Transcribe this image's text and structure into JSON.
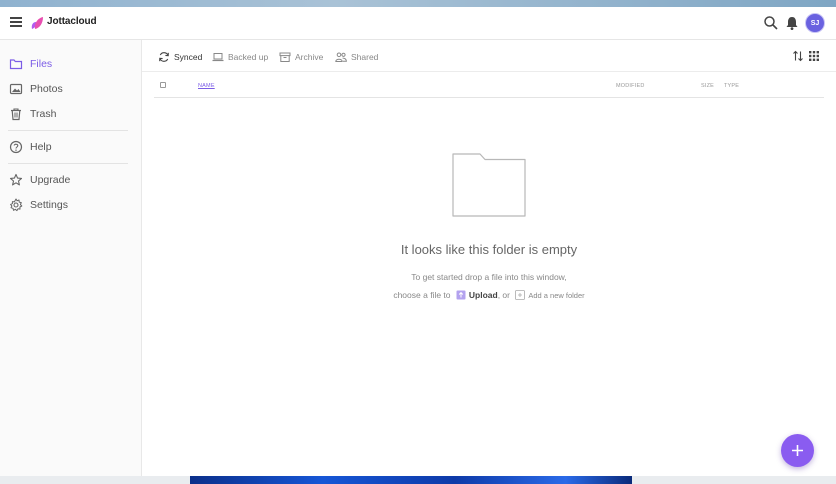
{
  "app": {
    "brand": "Jottacloud",
    "avatar_initials": "SJ",
    "accent_color": "#7b5ce6"
  },
  "header": {
    "icons": [
      "menu-icon",
      "search-icon",
      "bell-icon"
    ]
  },
  "sidebar": {
    "items": [
      {
        "label": "Files",
        "icon": "folder-icon",
        "active": true
      },
      {
        "label": "Photos",
        "icon": "photo-icon",
        "active": false
      },
      {
        "label": "Trash",
        "icon": "trash-icon",
        "active": false
      },
      {
        "label": "Help",
        "icon": "help-icon",
        "active": false
      },
      {
        "label": "Upgrade",
        "icon": "star-icon",
        "active": false
      },
      {
        "label": "Settings",
        "icon": "gear-icon",
        "active": false
      }
    ]
  },
  "tabs": [
    {
      "label": "Synced",
      "icon": "sync-icon",
      "active": true
    },
    {
      "label": "Backed up",
      "icon": "laptop-icon",
      "active": false
    },
    {
      "label": "Archive",
      "icon": "archive-icon",
      "active": false
    },
    {
      "label": "Shared",
      "icon": "shared-icon",
      "active": false
    }
  ],
  "columns": {
    "name": "NAME",
    "modified": "MODIFIED",
    "size": "SIZE",
    "type": "TYPE"
  },
  "empty_state": {
    "title": "It looks like this folder is empty",
    "line1": "To get started drop a file into this window,",
    "line2_prefix": "choose a file to",
    "upload_label": "Upload",
    "line2_middle": ", or",
    "add_folder_label": "Add a new folder"
  }
}
